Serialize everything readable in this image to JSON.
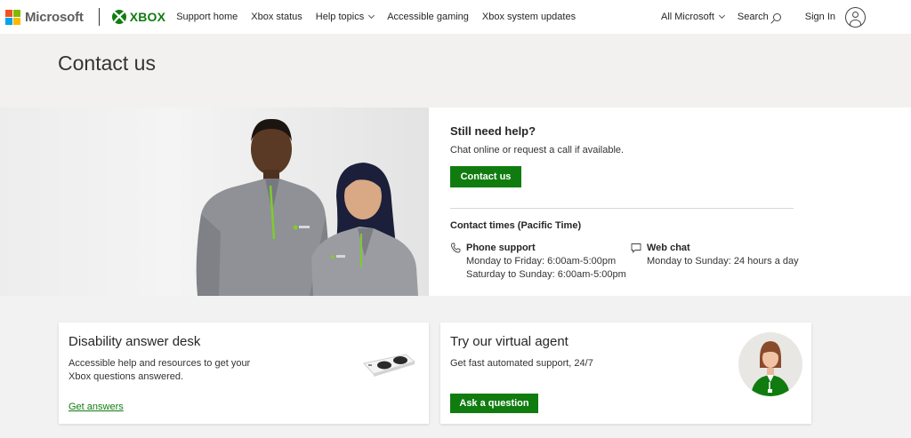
{
  "colors": {
    "brand_green": "#107c10",
    "ms_red": "#f25022",
    "ms_green": "#7fba00",
    "ms_blue": "#00a4ef",
    "ms_yellow": "#ffb900"
  },
  "header": {
    "ms_logo_text": "Microsoft",
    "xbox_logo_text": "XBOX",
    "nav": [
      {
        "label": "Support home"
      },
      {
        "label": "Xbox status"
      },
      {
        "label": "Help topics",
        "icon": "chevron-down-icon"
      },
      {
        "label": "Accessible gaming"
      },
      {
        "label": "Xbox system updates"
      }
    ],
    "all_microsoft": "All Microsoft",
    "search_label": "Search",
    "sign_in": "Sign In"
  },
  "page": {
    "title": "Contact us"
  },
  "hero": {
    "help_title": "Still need help?",
    "help_sub": "Chat online or request a call if available.",
    "contact_button": "Contact us",
    "times_title": "Contact times (Pacific Time)",
    "phone": {
      "label": "Phone support",
      "icon": "phone-icon",
      "lines": [
        "Monday to Friday: 6:00am-5:00pm",
        "Saturday to Sunday: 6:00am-5:00pm"
      ]
    },
    "chat": {
      "label": "Web chat",
      "icon": "chat-icon",
      "lines": [
        "Monday to Sunday: 24 hours a day"
      ]
    }
  },
  "cards": {
    "disability": {
      "title": "Disability answer desk",
      "description": "Accessible help and resources to get your Xbox questions answered.",
      "link": "Get answers"
    },
    "agent": {
      "title": "Try our virtual agent",
      "description": "Get fast automated support, 24/7",
      "button": "Ask a question"
    }
  }
}
